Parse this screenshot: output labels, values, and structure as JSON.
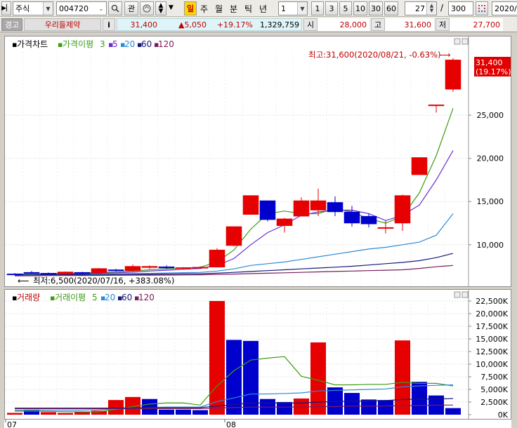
{
  "toolbar": {
    "market_select": "주식",
    "code_input": "004720",
    "search_icon": "magnifier-icon",
    "watch_button": "관",
    "period_buttons": [
      "일",
      "주",
      "월",
      "분",
      "틱",
      "년"
    ],
    "interval_select": "1",
    "interval_buttons": [
      "1",
      "3",
      "5",
      "10",
      "30",
      "60"
    ],
    "count_value": "27",
    "count_separator": "/",
    "count_total": "300",
    "date_value": "2020/"
  },
  "quote": {
    "warning_label": "경고",
    "stock_name": "우리들제약",
    "info_button": "i",
    "price": "31,400",
    "change": "▲5,050",
    "change_pct": "+19.17%",
    "volume": "1,329,759",
    "open_label": "시",
    "open": "28,000",
    "high_label": "고",
    "high": "31,600",
    "low_label": "저",
    "low": "27,700"
  },
  "colors": {
    "up": "#e60000",
    "down": "#0000cc",
    "ma3": "#3c9c14",
    "ma5": "#6b2bd6",
    "ma20": "#2b8ad6",
    "ma60": "#18187a",
    "ma120": "#7a1b5a"
  },
  "price_legend": {
    "chart": "가격차트",
    "ma": "가격이평",
    "periods": [
      "3",
      "5",
      "20",
      "60",
      "120"
    ]
  },
  "volume_legend": {
    "chart": "거래량",
    "ma": "거래이평",
    "periods": [
      "5",
      "20",
      "60",
      "120"
    ]
  },
  "annotations": {
    "high": "최고:31,600(2020/08/21, -0.63%)",
    "low": "최저:6,500(2020/07/16, +383.08%)",
    "last_price": "31,400",
    "last_pct": "(19.17%)"
  },
  "chart_data": [
    {
      "type": "candlestick",
      "title": "가격차트",
      "ylim": [
        6000,
        33000
      ],
      "y_ticks": [
        10000,
        15000,
        20000,
        25000
      ],
      "y_tick_labels": [
        "10,000",
        "15,000",
        "20,000",
        "25,000"
      ],
      "candles": [
        {
          "o": 6620,
          "h": 6720,
          "l": 6500,
          "c": 6560
        },
        {
          "o": 6800,
          "h": 6950,
          "l": 6650,
          "c": 6700
        },
        {
          "o": 6700,
          "h": 6780,
          "l": 6600,
          "c": 6660
        },
        {
          "o": 6600,
          "h": 6900,
          "l": 6560,
          "c": 6850
        },
        {
          "o": 6800,
          "h": 6860,
          "l": 6600,
          "c": 6650
        },
        {
          "o": 6750,
          "h": 7300,
          "l": 6700,
          "c": 7250
        },
        {
          "o": 7100,
          "h": 7200,
          "l": 6900,
          "c": 7000
        },
        {
          "o": 7000,
          "h": 7700,
          "l": 6900,
          "c": 7500
        },
        {
          "o": 7350,
          "h": 7600,
          "l": 7200,
          "c": 7500
        },
        {
          "o": 7450,
          "h": 7600,
          "l": 7200,
          "c": 7300
        },
        {
          "o": 7250,
          "h": 7400,
          "l": 7150,
          "c": 7350
        },
        {
          "o": 7300,
          "h": 7500,
          "l": 7250,
          "c": 7400
        },
        {
          "o": 7400,
          "h": 9600,
          "l": 7350,
          "c": 9400
        },
        {
          "o": 9900,
          "h": 12100,
          "l": 9800,
          "c": 12100
        },
        {
          "o": 13500,
          "h": 15700,
          "l": 13500,
          "c": 15700
        },
        {
          "o": 15100,
          "h": 15100,
          "l": 12700,
          "c": 12900
        },
        {
          "o": 12200,
          "h": 13100,
          "l": 11400,
          "c": 13000
        },
        {
          "o": 13300,
          "h": 15500,
          "l": 13300,
          "c": 15100
        },
        {
          "o": 14000,
          "h": 16500,
          "l": 13300,
          "c": 15100
        },
        {
          "o": 14900,
          "h": 15600,
          "l": 13300,
          "c": 13800
        },
        {
          "o": 13800,
          "h": 14500,
          "l": 12100,
          "c": 12500
        },
        {
          "o": 13300,
          "h": 13600,
          "l": 12000,
          "c": 12400
        },
        {
          "o": 11900,
          "h": 12800,
          "l": 11300,
          "c": 12000
        },
        {
          "o": 12500,
          "h": 15800,
          "l": 11600,
          "c": 15700
        },
        {
          "o": 18100,
          "h": 20100,
          "l": 18100,
          "c": 20100
        },
        {
          "o": 26200,
          "h": 26200,
          "l": 25300,
          "c": 26200
        },
        {
          "o": 28000,
          "h": 31600,
          "l": 27700,
          "c": 31400
        }
      ],
      "ma_series": [
        {
          "name": "3",
          "values": [
            6600,
            6620,
            6640,
            6680,
            6720,
            6780,
            6850,
            6950,
            7100,
            7200,
            7300,
            7380,
            8000,
            9400,
            11800,
            13600,
            13900,
            13600,
            13600,
            14200,
            13800,
            13000,
            12500,
            13300,
            16000,
            20300,
            25800
          ]
        },
        {
          "name": "5",
          "values": [
            6500,
            6560,
            6600,
            6620,
            6660,
            6700,
            6750,
            6820,
            6950,
            7050,
            7150,
            7250,
            7600,
            8400,
            10000,
            11400,
            12300,
            13400,
            13800,
            14000,
            14000,
            13600,
            12800,
            13400,
            14600,
            17500,
            20900
          ]
        },
        {
          "name": "20",
          "values": [
            6550,
            6560,
            6570,
            6580,
            6590,
            6600,
            6620,
            6650,
            6680,
            6720,
            6760,
            6800,
            6950,
            7200,
            7600,
            7800,
            8000,
            8300,
            8600,
            8900,
            9200,
            9500,
            9700,
            10000,
            10300,
            11100,
            13600
          ]
        },
        {
          "name": "60",
          "values": [
            6500,
            6510,
            6520,
            6530,
            6540,
            6550,
            6560,
            6570,
            6580,
            6600,
            6620,
            6640,
            6700,
            6800,
            6900,
            7000,
            7100,
            7200,
            7300,
            7400,
            7500,
            7650,
            7800,
            7950,
            8150,
            8500,
            9000
          ]
        },
        {
          "name": "120",
          "values": [
            6400,
            6410,
            6420,
            6430,
            6440,
            6450,
            6460,
            6470,
            6480,
            6490,
            6500,
            6520,
            6550,
            6600,
            6650,
            6700,
            6750,
            6800,
            6850,
            6900,
            6950,
            7000,
            7050,
            7100,
            7250,
            7450,
            7600
          ]
        }
      ]
    },
    {
      "type": "bar",
      "title": "거래량",
      "ylim": [
        0,
        22500
      ],
      "y_ticks": [
        0,
        2500,
        5000,
        7500,
        10000,
        12500,
        15000,
        17500,
        20000,
        22500
      ],
      "y_tick_labels": [
        "0K",
        "2,500K",
        "5,000K",
        "7,500K",
        "10,000K",
        "12,500K",
        "15,000K",
        "17,500K",
        "20,000K",
        "22,500K"
      ],
      "values": [
        350,
        1000,
        500,
        350,
        550,
        800,
        2900,
        3500,
        3100,
        1000,
        1000,
        900,
        22500,
        14800,
        14600,
        3100,
        2500,
        3200,
        14300,
        5400,
        4300,
        3000,
        2900,
        14700,
        6500,
        3800,
        1300
      ],
      "up": [
        true,
        false,
        true,
        true,
        true,
        true,
        true,
        true,
        false,
        false,
        false,
        false,
        true,
        false,
        false,
        false,
        false,
        true,
        true,
        false,
        false,
        false,
        false,
        true,
        false,
        false,
        false
      ],
      "ma_series": [
        {
          "name": "5",
          "values": [
            700,
            700,
            650,
            600,
            550,
            560,
            1050,
            1600,
            2100,
            2300,
            2300,
            1900,
            5700,
            8700,
            10800,
            11200,
            11500,
            7600,
            6800,
            5900,
            5900,
            6000,
            6000,
            6400,
            6200,
            6200,
            5700
          ]
        },
        {
          "name": "20",
          "values": [
            900,
            900,
            900,
            900,
            900,
            1000,
            1100,
            1300,
            1400,
            1500,
            1500,
            1500,
            2600,
            3300,
            4100,
            4100,
            4200,
            4300,
            4700,
            4800,
            4900,
            5000,
            5100,
            5500,
            5700,
            5800,
            5900
          ]
        },
        {
          "name": "60",
          "values": [
            1300,
            1300,
            1300,
            1300,
            1300,
            1300,
            1300,
            1350,
            1400,
            1400,
            1400,
            1400,
            1700,
            2000,
            2300,
            2300,
            2300,
            2300,
            2500,
            2600,
            2700,
            2700,
            2800,
            3000,
            3100,
            3100,
            3200
          ]
        },
        {
          "name": "120",
          "values": [
            1200,
            1200,
            1200,
            1200,
            1200,
            1200,
            1200,
            1200,
            1200,
            1200,
            1200,
            1200,
            1300,
            1400,
            1500,
            1500,
            1500,
            1500,
            1600,
            1600,
            1700,
            1700,
            1700,
            1800,
            1800,
            1900,
            1900
          ]
        }
      ]
    }
  ],
  "xaxis": {
    "labels": [
      {
        "text": "07",
        "index": 0
      },
      {
        "text": "08",
        "index": 13
      }
    ]
  }
}
